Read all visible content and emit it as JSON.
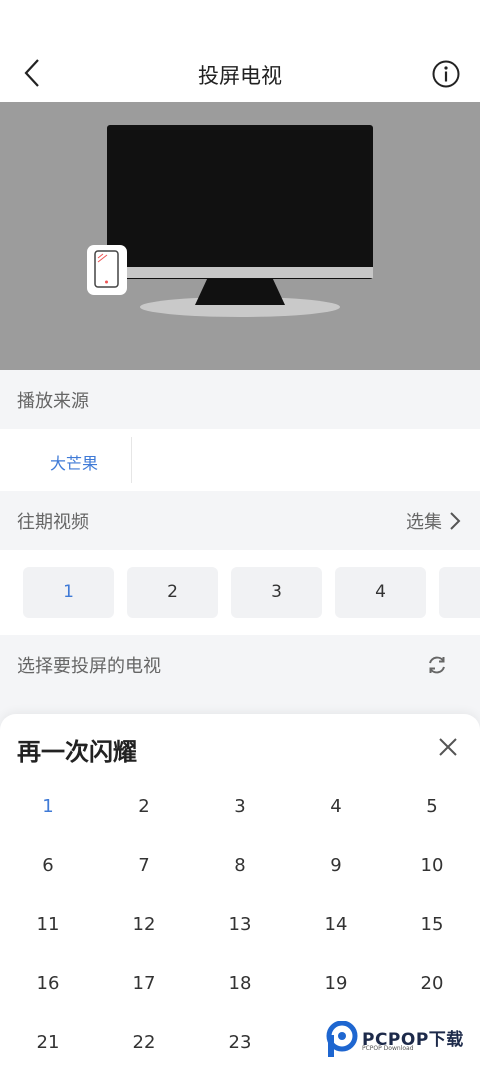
{
  "header": {
    "title": "投屏电视"
  },
  "source": {
    "section_label": "播放来源",
    "items": [
      "大芒果"
    ]
  },
  "episodes": {
    "section_label": "往期视频",
    "select_label": "选集",
    "visible": [
      "1",
      "2",
      "3",
      "4"
    ],
    "active_index": 0
  },
  "tv": {
    "section_label": "选择要投屏的电视"
  },
  "sheet": {
    "title": "再一次闪耀",
    "episodes": [
      "1",
      "2",
      "3",
      "4",
      "5",
      "6",
      "7",
      "8",
      "9",
      "10",
      "11",
      "12",
      "13",
      "14",
      "15",
      "16",
      "17",
      "18",
      "19",
      "20",
      "21",
      "22",
      "23"
    ],
    "active_index": 0
  },
  "watermark": {
    "text": "PCPOP下载",
    "subtext": "PCPOP Download"
  },
  "colors": {
    "accent": "#3f7ad6",
    "preview_bg": "#9c9c9c"
  }
}
